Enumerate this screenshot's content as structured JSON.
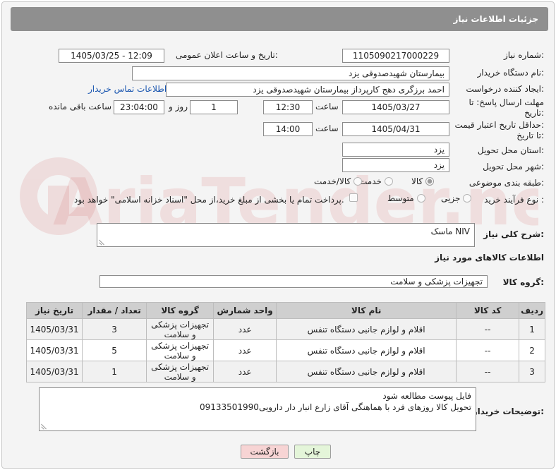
{
  "header": {
    "title": "جزئیات اطلاعات نیاز"
  },
  "fields": {
    "need_number_label": "شماره نیاز:",
    "need_number": "1105090217000229",
    "announce_datetime_label": "تاریخ و ساعت اعلان عمومی:",
    "announce_datetime": "1405/03/25 - 12:09",
    "buyer_org_label": "نام دستگاه خریدار:",
    "buyer_org": "بیمارستان شهیدصدوقی یزد",
    "requester_label": "ایجاد کننده درخواست:",
    "requester": "احمد برزگری دهج کارپرداز بیمارستان شهیدصدوقی یزد",
    "contact_link": "اطلاعات تماس خریدار",
    "reply_deadline_label_1": "مهلت ارسال پاسخ: تا",
    "reply_deadline_label_2": "تاریخ:",
    "reply_date": "1405/03/27",
    "time_label": "ساعت",
    "reply_time": "12:30",
    "days_value": "1",
    "days_label": "روز و",
    "remaining_time": "23:04:00",
    "remaining_label": "ساعت باقی مانده",
    "validity_label_1": "حداقل تاریخ اعتبار قیمت:",
    "validity_label_2": "تا تاریخ:",
    "validity_date": "1405/04/31",
    "validity_time": "14:00",
    "province_label": "استان محل تحویل:",
    "province": "یزد",
    "city_label": "شهر محل تحویل:",
    "city": "یزد",
    "category_label": "طبقه بندی موضوعی:",
    "category_options": [
      "کالا",
      "خدمت",
      "کالا/خدمت"
    ],
    "category_selected": "کالا",
    "purchase_type_label": "نوع فرآیند خرید :",
    "purchase_type_options": [
      "جزیی",
      "متوسط"
    ],
    "payment_note": "پرداخت تمام یا بخشی از مبلغ خرید،از محل \"اسناد خزانه اسلامی\" خواهد بود."
  },
  "description": {
    "label": "شرح کلی نیاز:",
    "value": "ماسک NIV"
  },
  "goods_section": {
    "title": "اطلاعات کالاهای مورد نیاز",
    "group_label": "گروه کالا:",
    "group_value": "تجهیزات پزشکی و سلامت"
  },
  "table": {
    "headers": [
      "ردیف",
      "کد کالا",
      "نام کالا",
      "واحد شمارش",
      "گروه کالا",
      "تعداد / مقدار",
      "تاریخ نیاز"
    ],
    "rows": [
      [
        "1",
        "--",
        "اقلام و لوازم جانبی دستگاه تنفس",
        "عدد",
        "تجهیزات پزشکی و سلامت",
        "3",
        "1405/03/31"
      ],
      [
        "2",
        "--",
        "اقلام و لوازم جانبی دستگاه تنفس",
        "عدد",
        "تجهیزات پزشکی و سلامت",
        "5",
        "1405/03/31"
      ],
      [
        "3",
        "--",
        "اقلام و لوازم جانبی دستگاه تنفس",
        "عدد",
        "تجهیزات پزشکی و سلامت",
        "1",
        "1405/03/31"
      ]
    ]
  },
  "buyer_notes": {
    "label": "توضیحات خریدار:",
    "line1": "فایل پیوست مطالعه شود",
    "line2": "تحویل کالا روزهای فرد با هماهنگی آقای زارع انبار دار دارویی09133501990"
  },
  "buttons": {
    "print": "چاپ",
    "back": "بازگشت"
  },
  "watermark": "AriaTender.net",
  "colors": {
    "header_bg": "#8f8f8f",
    "link": "#1a56b0",
    "back_button_bg": "#f7d4d4",
    "print_button_bg": "#e4f5d9"
  }
}
